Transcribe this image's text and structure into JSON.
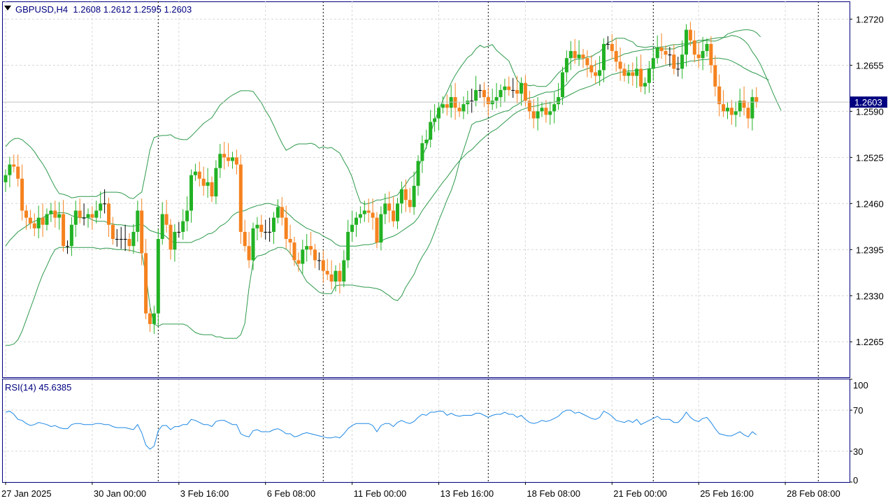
{
  "header": {
    "symbol": "GBPUSD,H4",
    "ohlc": "1.2608 1.2612 1.2595 1.2603",
    "price_label": "1.2603"
  },
  "rsi_panel": {
    "label": "RSI(14) 45.6385",
    "levels": [
      "100",
      "70",
      "30",
      "0"
    ]
  },
  "colors": {
    "bull": "#22b224",
    "bear": "#f5821f",
    "doji": "#000000",
    "bands": "#2e9a4c",
    "rsi": "#1e88e5",
    "grid": "#d8d8d8",
    "frame": "#000080",
    "price_marker_bg": "#000080"
  },
  "chart_data": [
    {
      "type": "candlestick",
      "title": "GBPUSD,H4",
      "ylim": [
        1.2215,
        1.2745
      ],
      "y_ticks": [
        "1.2720",
        "1.2655",
        "1.2590",
        "1.2525",
        "1.2460",
        "1.2395",
        "1.2330",
        "1.2265"
      ],
      "x_ticks": [
        "27 Jan 2025",
        "30 Jan 00:00",
        "3 Feb 16:00",
        "6 Feb 08:00",
        "11 Feb 00:00",
        "13 Feb 16:00",
        "18 Feb 08:00",
        "21 Feb 00:00",
        "25 Feb 16:00",
        "28 Feb 08:00"
      ],
      "x_tick_index": [
        0,
        21,
        42,
        63,
        84,
        105,
        126,
        147,
        168,
        189
      ],
      "period_separators_index": [
        37,
        77,
        117,
        157,
        197
      ],
      "closes": [
        1.25,
        1.2515,
        1.2512,
        1.2495,
        1.245,
        1.244,
        1.2432,
        1.2425,
        1.244,
        1.243,
        1.2445,
        1.245,
        1.244,
        1.2445,
        1.24,
        1.24,
        1.243,
        1.245,
        1.244,
        1.244,
        1.2445,
        1.244,
        1.245,
        1.246,
        1.246,
        1.243,
        1.241,
        1.241,
        1.241,
        1.241,
        1.24,
        1.242,
        1.245,
        1.239,
        1.2305,
        1.229,
        1.2305,
        1.241,
        1.2445,
        1.243,
        1.2395,
        1.242,
        1.242,
        1.2435,
        1.245,
        1.25,
        1.2505,
        1.2495,
        1.2485,
        1.249,
        1.247,
        1.251,
        1.253,
        1.2525,
        1.252,
        1.2525,
        1.2515,
        1.242,
        1.24,
        1.238,
        1.2425,
        1.243,
        1.242,
        1.242,
        1.242,
        1.244,
        1.2455,
        1.244,
        1.241,
        1.2405,
        1.238,
        1.2375,
        1.2395,
        1.24,
        1.2395,
        1.238,
        1.238,
        1.2365,
        1.236,
        1.235,
        1.2365,
        1.235,
        1.238,
        1.242,
        1.243,
        1.244,
        1.2445,
        1.245,
        1.2447,
        1.244,
        1.2405,
        1.2445,
        1.246,
        1.245,
        1.2435,
        1.246,
        1.248,
        1.2465,
        1.2455,
        1.2485,
        1.252,
        1.2545,
        1.255,
        1.2575,
        1.258,
        1.2595,
        1.26,
        1.2595,
        1.261,
        1.2595,
        1.259,
        1.26,
        1.2605,
        1.2605,
        1.262,
        1.262,
        1.261,
        1.26,
        1.2605,
        1.261,
        1.262,
        1.2625,
        1.262,
        1.262,
        1.2615,
        1.263,
        1.2605,
        1.259,
        1.258,
        1.259,
        1.2595,
        1.2585,
        1.259,
        1.26,
        1.261,
        1.2645,
        1.2665,
        1.2675,
        1.2665,
        1.267,
        1.2665,
        1.2655,
        1.2645,
        1.264,
        1.2648,
        1.2685,
        1.2685,
        1.2675,
        1.266,
        1.265,
        1.264,
        1.2645,
        1.264,
        1.265,
        1.2625,
        1.263,
        1.265,
        1.2665,
        1.268,
        1.2675,
        1.267,
        1.267,
        1.265,
        1.265,
        1.267,
        1.2705,
        1.269,
        1.267,
        1.2665,
        1.2675,
        1.2685,
        1.2655,
        1.2625,
        1.26,
        1.259,
        1.2595,
        1.2585,
        1.259,
        1.2605,
        1.2595,
        1.258,
        1.261,
        1.2603
      ],
      "bands_upper": [
        1.254,
        1.2547,
        1.2551,
        1.2552,
        1.255,
        1.2545,
        1.254,
        1.2533,
        1.2524,
        1.2516,
        1.2506,
        1.2494,
        1.2483,
        1.2474,
        1.2473,
        1.2471,
        1.2468,
        1.2469,
        1.247,
        1.247,
        1.247,
        1.247,
        1.247,
        1.2473,
        1.2476,
        1.2476,
        1.2476,
        1.2476,
        1.2475,
        1.2472,
        1.2468,
        1.2467,
        1.2472,
        1.2476,
        1.2505,
        1.2536,
        1.2553,
        1.2555,
        1.2556,
        1.2556,
        1.2557,
        1.2553,
        1.2551,
        1.255,
        1.255,
        1.2555,
        1.2561,
        1.2567,
        1.2573,
        1.2577,
        1.2581,
        1.259,
        1.2599,
        1.2604,
        1.2609,
        1.2613,
        1.2616,
        1.2619,
        1.2619,
        1.2619,
        1.2618,
        1.261,
        1.2602,
        1.2591,
        1.2582,
        1.257,
        1.2557,
        1.2545,
        1.2535,
        1.2538,
        1.2542,
        1.2544,
        1.2544,
        1.2544,
        1.2545,
        1.2543,
        1.2538,
        1.254,
        1.2538,
        1.2539,
        1.2535,
        1.2531,
        1.252,
        1.251,
        1.2497,
        1.2478,
        1.2462,
        1.2459,
        1.246,
        1.2462,
        1.2465,
        1.2465,
        1.2467,
        1.2468,
        1.247,
        1.2472,
        1.248,
        1.2487,
        1.2496,
        1.25,
        1.2509,
        1.2526,
        1.254,
        1.2559,
        1.2576,
        1.2592,
        1.2606,
        1.2617,
        1.263,
        1.2641,
        1.265,
        1.2658,
        1.2666,
        1.267,
        1.2678,
        1.2683,
        1.268,
        1.2682,
        1.2684,
        1.2676,
        1.2671,
        1.2666,
        1.2661,
        1.2647,
        1.2634,
        1.2628,
        1.2628,
        1.2626,
        1.2627,
        1.2625,
        1.2625,
        1.2625,
        1.263,
        1.2637,
        1.2644,
        1.2649,
        1.2653,
        1.266,
        1.2663,
        1.2664,
        1.2664,
        1.2667,
        1.2667,
        1.2671,
        1.2674,
        1.268,
        1.2687,
        1.2689,
        1.2693,
        1.2693,
        1.2693,
        1.269,
        1.2688,
        1.2682,
        1.2681,
        1.268,
        1.2681,
        1.2682,
        1.2679,
        1.2678,
        1.2678,
        1.2678,
        1.2678,
        1.2681,
        1.2682,
        1.2684,
        1.2685,
        1.2687,
        1.2687,
        1.2689,
        1.269,
        1.2689,
        1.2689,
        1.2691,
        1.2694,
        1.2699,
        1.2701,
        1.2703,
        1.2704,
        1.2705,
        1.2705,
        1.2704,
        1.2701,
        1.2695
      ],
      "bands_middle": [
        1.24,
        1.2408,
        1.2414,
        1.242,
        1.2424,
        1.2428,
        1.2432,
        1.2435,
        1.2437,
        1.244,
        1.2443,
        1.2446,
        1.2446,
        1.2447,
        1.2447,
        1.2446,
        1.2443,
        1.2441,
        1.244,
        1.244,
        1.244,
        1.2437,
        1.2435,
        1.2435,
        1.2435,
        1.2432,
        1.2431,
        1.243,
        1.243,
        1.2429,
        1.2428,
        1.2428,
        1.243,
        1.2431,
        1.2427,
        1.2422,
        1.242,
        1.2418,
        1.2417,
        1.2413,
        1.2407,
        1.2405,
        1.2405,
        1.2405,
        1.2405,
        1.2405,
        1.2408,
        1.241,
        1.2413,
        1.2417,
        1.2418,
        1.2422,
        1.2428,
        1.2431,
        1.2436,
        1.2443,
        1.2447,
        1.2449,
        1.245,
        1.2453,
        1.2455,
        1.2457,
        1.2458,
        1.246,
        1.246,
        1.2458,
        1.2457,
        1.2453,
        1.2448,
        1.2443,
        1.2437,
        1.2433,
        1.2429,
        1.2425,
        1.2423,
        1.242,
        1.2418,
        1.2414,
        1.2411,
        1.2408,
        1.2403,
        1.24,
        1.24,
        1.24,
        1.24,
        1.24,
        1.2401,
        1.2402,
        1.2402,
        1.2403,
        1.2405,
        1.2407,
        1.241,
        1.2412,
        1.2414,
        1.2417,
        1.2421,
        1.2425,
        1.2429,
        1.2433,
        1.244,
        1.245,
        1.2458,
        1.2466,
        1.2474,
        1.2482,
        1.249,
        1.2497,
        1.2505,
        1.2513,
        1.252,
        1.2526,
        1.2532,
        1.2536,
        1.2542,
        1.2548,
        1.2553,
        1.2558,
        1.2562,
        1.2565,
        1.257,
        1.2575,
        1.258,
        1.2585,
        1.2589,
        1.2592,
        1.2594,
        1.2596,
        1.2597,
        1.2598,
        1.26,
        1.2601,
        1.2602,
        1.2603,
        1.2605,
        1.2608,
        1.2611,
        1.2614,
        1.2617,
        1.262,
        1.2622,
        1.2624,
        1.2626,
        1.2629,
        1.2632,
        1.2636,
        1.2639,
        1.2642,
        1.2643,
        1.2645,
        1.2646,
        1.2647,
        1.2647,
        1.2648,
        1.2648,
        1.2649,
        1.265,
        1.2651,
        1.2652,
        1.2653,
        1.2655,
        1.2656,
        1.2657,
        1.2657,
        1.2658,
        1.2659,
        1.2661,
        1.2661,
        1.2662,
        1.2663,
        1.2663,
        1.2664,
        1.2665,
        1.2665,
        1.2664,
        1.2663,
        1.2661,
        1.2658,
        1.2655,
        1.2651,
        1.2648,
        1.2645,
        1.2643,
        1.264,
        1.2637,
        1.2634
      ],
      "bands_lower": [
        1.226,
        1.226,
        1.2262,
        1.2268,
        1.228,
        1.2296,
        1.2312,
        1.2328,
        1.2345,
        1.236,
        1.2372,
        1.2385,
        1.2395,
        1.2398,
        1.2398,
        1.2398,
        1.2398,
        1.2398,
        1.2398,
        1.2398,
        1.2398,
        1.2398,
        1.2397,
        1.2396,
        1.2397,
        1.2397,
        1.2396,
        1.2395,
        1.2395,
        1.2395,
        1.2394,
        1.2393,
        1.2391,
        1.239,
        1.236,
        1.2315,
        1.229,
        1.2287,
        1.229,
        1.229,
        1.229,
        1.229,
        1.229,
        1.229,
        1.2288,
        1.2283,
        1.2278,
        1.2276,
        1.2275,
        1.2275,
        1.2275,
        1.2272,
        1.2272,
        1.227,
        1.227,
        1.227,
        1.227,
        1.2275,
        1.2291,
        1.2341,
        1.2378,
        1.2386,
        1.2387,
        1.2389,
        1.2393,
        1.2395,
        1.2398,
        1.2398,
        1.2396,
        1.239,
        1.238,
        1.237,
        1.236,
        1.235,
        1.2345,
        1.234,
        1.2335,
        1.2333,
        1.2333,
        1.2333,
        1.2344,
        1.2345,
        1.2345,
        1.2345,
        1.2345,
        1.2344,
        1.2343,
        1.2342,
        1.2342,
        1.2341,
        1.234,
        1.2338,
        1.2334,
        1.233,
        1.2325,
        1.2323,
        1.233,
        1.2342,
        1.2351,
        1.236,
        1.2374,
        1.2385,
        1.2394,
        1.2405,
        1.242,
        1.2436,
        1.245,
        1.2465,
        1.2478,
        1.2495,
        1.2518,
        1.2535,
        1.2553,
        1.2571,
        1.2575,
        1.2576,
        1.2578,
        1.258,
        1.2583,
        1.2586,
        1.2588,
        1.259,
        1.2591,
        1.2596,
        1.2599,
        1.2603,
        1.2607,
        1.2609,
        1.261,
        1.2613,
        1.2615,
        1.2617,
        1.2617,
        1.2618,
        1.262,
        1.2623,
        1.2628,
        1.2635,
        1.2641,
        1.2646,
        1.2648,
        1.265,
        1.2652,
        1.2656,
        1.2658,
        1.266,
        1.2662,
        1.2664,
        1.2666,
        1.2668,
        1.2671,
        1.2672,
        1.2674,
        1.2675,
        1.2676,
        1.2677,
        1.2677,
        1.2678,
        1.268,
        1.2681,
        1.2681,
        1.2683,
        1.2684,
        1.2684,
        1.2685,
        1.2685,
        1.2687,
        1.2688,
        1.269,
        1.269,
        1.2691,
        1.2692,
        1.2693,
        1.2694,
        1.2694,
        1.2695,
        1.2697,
        1.2696,
        1.2694,
        1.269,
        1.2684,
        1.2674,
        1.2666,
        1.2656,
        1.2643,
        1.263,
        1.2616,
        1.2603,
        1.2591
      ]
    },
    {
      "type": "line",
      "title": "RSI(14) 45.6385",
      "ylim": [
        0,
        100
      ],
      "y_ticks": [
        100,
        70,
        30,
        0
      ],
      "values": [
        68,
        69,
        66,
        61,
        60,
        57,
        55,
        56,
        58,
        57,
        56,
        54,
        55,
        53,
        52,
        52,
        56,
        57,
        57,
        56,
        56,
        56,
        57,
        57,
        56,
        56,
        54,
        53,
        53,
        53,
        52,
        51,
        56,
        48,
        36,
        32,
        35,
        50,
        55,
        55,
        51,
        54,
        54,
        56,
        56,
        61,
        60,
        58,
        56,
        56,
        54,
        59,
        60,
        60,
        58,
        56,
        56,
        47,
        45,
        44,
        50,
        51,
        49,
        49,
        49,
        51,
        52,
        50,
        47,
        47,
        44,
        45,
        47,
        48,
        47,
        46,
        45,
        44,
        43,
        43,
        44,
        43,
        47,
        52,
        55,
        57,
        57,
        57,
        57,
        55,
        49,
        55,
        57,
        57,
        54,
        58,
        60,
        58,
        57,
        59,
        63,
        66,
        65,
        68,
        68,
        69,
        69,
        65,
        67,
        65,
        64,
        65,
        65,
        65,
        67,
        67,
        65,
        63,
        65,
        66,
        66,
        68,
        66,
        66,
        63,
        65,
        61,
        58,
        57,
        58,
        60,
        59,
        60,
        62,
        64,
        68,
        70,
        70,
        67,
        68,
        66,
        64,
        62,
        61,
        63,
        69,
        67,
        64,
        60,
        59,
        58,
        60,
        58,
        61,
        56,
        58,
        60,
        62,
        64,
        61,
        61,
        61,
        58,
        58,
        62,
        68,
        63,
        60,
        59,
        62,
        63,
        58,
        52,
        47,
        46,
        45,
        45,
        47,
        49,
        46,
        44,
        49,
        46
      ]
    }
  ]
}
